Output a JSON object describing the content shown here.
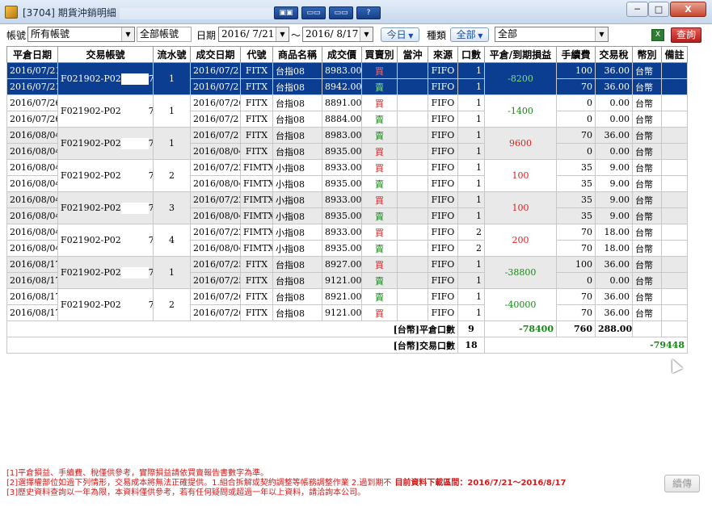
{
  "window": {
    "title": "[3704] 期貨沖銷明細",
    "buttons": [
      "▣▣",
      "▭▭",
      "▭▭",
      "?"
    ],
    "min_glyph": "─",
    "max_glyph": "□",
    "close_glyph": "X"
  },
  "toolbar": {
    "account_label": "帳號",
    "account_value": "所有帳號",
    "account_name": "全部帳號",
    "date_label": "日期",
    "date_from": "2016/ 7/21",
    "date_sep": "〜",
    "date_to": "2016/ 8/17",
    "today_label": "今日",
    "kind_label": "種類",
    "kind_value": "全部",
    "filter_value": "全部",
    "excel_icon": "X",
    "query_label": "查詢"
  },
  "columns": [
    "平倉日期",
    "交易帳號",
    "流水號",
    "成交日期",
    "代號",
    "商品名稱",
    "成交價",
    "買賣別",
    "當沖",
    "來源",
    "口數",
    "平倉/到期損益",
    "手續費",
    "交易稅",
    "幣別",
    "備註"
  ],
  "groups": [
    {
      "close_date": [
        "2016/07/21",
        "2016/07/21"
      ],
      "account": "F021902-P02",
      "acct_tail": "7",
      "serial": "1",
      "pnl": "-8200",
      "pnl_sign": "neg",
      "selected": true,
      "rows": [
        {
          "trade_date": "2016/07/21",
          "code": "FITX",
          "name": "台指08",
          "price": "8983.00",
          "side": "買",
          "side_cls": "buy",
          "daytrade": "",
          "source": "FIFO",
          "qty": "1",
          "fee": "100",
          "tax": "36.00",
          "currency": "台幣",
          "note": ""
        },
        {
          "trade_date": "2016/07/21",
          "code": "FITX",
          "name": "台指08",
          "price": "8942.00",
          "side": "賣",
          "side_cls": "sell",
          "daytrade": "",
          "source": "FIFO",
          "qty": "1",
          "fee": "70",
          "tax": "36.00",
          "currency": "台幣",
          "note": ""
        }
      ]
    },
    {
      "close_date": [
        "2016/07/26",
        "2016/07/26"
      ],
      "account": "F021902-P02",
      "acct_tail": "7",
      "serial": "1",
      "pnl": "-1400",
      "pnl_sign": "neg",
      "selected": false,
      "rows": [
        {
          "trade_date": "2016/07/26",
          "code": "FITX",
          "name": "台指08",
          "price": "8891.00",
          "side": "買",
          "side_cls": "buy",
          "daytrade": "",
          "source": "FIFO",
          "qty": "1",
          "fee": "0",
          "tax": "0.00",
          "currency": "台幣",
          "note": ""
        },
        {
          "trade_date": "2016/07/21",
          "code": "FITX",
          "name": "台指08",
          "price": "8884.00",
          "side": "賣",
          "side_cls": "sell",
          "daytrade": "",
          "source": "FIFO",
          "qty": "1",
          "fee": "0",
          "tax": "0.00",
          "currency": "台幣",
          "note": ""
        }
      ]
    },
    {
      "close_date": [
        "2016/08/04",
        "2016/08/04"
      ],
      "account": "F021902-P02",
      "acct_tail": "7",
      "serial": "1",
      "pnl": "9600",
      "pnl_sign": "pos",
      "selected": false,
      "rows": [
        {
          "trade_date": "2016/07/21",
          "code": "FITX",
          "name": "台指08",
          "price": "8983.00",
          "side": "賣",
          "side_cls": "sell",
          "daytrade": "",
          "source": "FIFO",
          "qty": "1",
          "fee": "70",
          "tax": "36.00",
          "currency": "台幣",
          "note": ""
        },
        {
          "trade_date": "2016/08/04",
          "code": "FITX",
          "name": "台指08",
          "price": "8935.00",
          "side": "買",
          "side_cls": "buy",
          "daytrade": "",
          "source": "FIFO",
          "qty": "1",
          "fee": "0",
          "tax": "0.00",
          "currency": "台幣",
          "note": ""
        }
      ]
    },
    {
      "close_date": [
        "2016/08/04",
        "2016/08/04"
      ],
      "account": "F021902-P02",
      "acct_tail": "7",
      "serial": "2",
      "pnl": "100",
      "pnl_sign": "pos",
      "selected": false,
      "rows": [
        {
          "trade_date": "2016/07/22",
          "code": "FIMTX",
          "name": "小指08",
          "price": "8933.00",
          "side": "買",
          "side_cls": "buy",
          "daytrade": "",
          "source": "FIFO",
          "qty": "1",
          "fee": "35",
          "tax": "9.00",
          "currency": "台幣",
          "note": ""
        },
        {
          "trade_date": "2016/08/04",
          "code": "FIMTX",
          "name": "小指08",
          "price": "8935.00",
          "side": "賣",
          "side_cls": "sell",
          "daytrade": "",
          "source": "FIFO",
          "qty": "1",
          "fee": "35",
          "tax": "9.00",
          "currency": "台幣",
          "note": ""
        }
      ]
    },
    {
      "close_date": [
        "2016/08/04",
        "2016/08/04"
      ],
      "account": "F021902-P02",
      "acct_tail": "7",
      "serial": "3",
      "pnl": "100",
      "pnl_sign": "pos",
      "selected": false,
      "rows": [
        {
          "trade_date": "2016/07/22",
          "code": "FIMTX",
          "name": "小指08",
          "price": "8933.00",
          "side": "買",
          "side_cls": "buy",
          "daytrade": "",
          "source": "FIFO",
          "qty": "1",
          "fee": "35",
          "tax": "9.00",
          "currency": "台幣",
          "note": ""
        },
        {
          "trade_date": "2016/08/04",
          "code": "FIMTX",
          "name": "小指08",
          "price": "8935.00",
          "side": "賣",
          "side_cls": "sell",
          "daytrade": "",
          "source": "FIFO",
          "qty": "1",
          "fee": "35",
          "tax": "9.00",
          "currency": "台幣",
          "note": ""
        }
      ]
    },
    {
      "close_date": [
        "2016/08/04",
        "2016/08/04"
      ],
      "account": "F021902-P02",
      "acct_tail": "7",
      "serial": "4",
      "pnl": "200",
      "pnl_sign": "pos",
      "selected": false,
      "rows": [
        {
          "trade_date": "2016/07/22",
          "code": "FIMTX",
          "name": "小指08",
          "price": "8933.00",
          "side": "買",
          "side_cls": "buy",
          "daytrade": "",
          "source": "FIFO",
          "qty": "2",
          "fee": "70",
          "tax": "18.00",
          "currency": "台幣",
          "note": ""
        },
        {
          "trade_date": "2016/08/04",
          "code": "FIMTX",
          "name": "小指08",
          "price": "8935.00",
          "side": "賣",
          "side_cls": "sell",
          "daytrade": "",
          "source": "FIFO",
          "qty": "2",
          "fee": "70",
          "tax": "18.00",
          "currency": "台幣",
          "note": ""
        }
      ]
    },
    {
      "close_date": [
        "2016/08/17",
        "2016/08/17"
      ],
      "account": "F021902-P02",
      "acct_tail": "7",
      "serial": "1",
      "pnl": "-38800",
      "pnl_sign": "neg",
      "selected": false,
      "rows": [
        {
          "trade_date": "2016/07/25",
          "code": "FITX",
          "name": "台指08",
          "price": "8927.00",
          "side": "買",
          "side_cls": "buy",
          "daytrade": "",
          "source": "FIFO",
          "qty": "1",
          "fee": "100",
          "tax": "36.00",
          "currency": "台幣",
          "note": ""
        },
        {
          "trade_date": "2016/07/25",
          "code": "FITX",
          "name": "台指08",
          "price": "9121.00",
          "side": "賣",
          "side_cls": "sell",
          "daytrade": "",
          "source": "FIFO",
          "qty": "1",
          "fee": "0",
          "tax": "0.00",
          "currency": "台幣",
          "note": ""
        }
      ]
    },
    {
      "close_date": [
        "2016/08/17",
        "2016/08/17"
      ],
      "account": "F021902-P02",
      "acct_tail": "7",
      "serial": "2",
      "pnl": "-40000",
      "pnl_sign": "neg",
      "selected": false,
      "rows": [
        {
          "trade_date": "2016/07/26",
          "code": "FITX",
          "name": "台指08",
          "price": "8921.00",
          "side": "賣",
          "side_cls": "sell",
          "daytrade": "",
          "source": "FIFO",
          "qty": "1",
          "fee": "70",
          "tax": "36.00",
          "currency": "台幣",
          "note": ""
        },
        {
          "trade_date": "2016/07/26",
          "code": "FITX",
          "name": "台指08",
          "price": "9121.00",
          "side": "買",
          "side_cls": "buy",
          "daytrade": "",
          "source": "FIFO",
          "qty": "1",
          "fee": "70",
          "tax": "36.00",
          "currency": "台幣",
          "note": ""
        }
      ]
    }
  ],
  "summary": {
    "close_label": "[台幣]平倉口數",
    "close_qty": "9",
    "close_pnl": "-78400",
    "close_fee": "760",
    "close_tax": "288.00",
    "trade_label": "[台幣]交易口數",
    "trade_qty": "18",
    "trade_net": "-79448"
  },
  "footer": {
    "note1": "[1]平倉損益、手續費、稅僅供參考，實際損益請依買賣報告書數字為準。",
    "note2": "[2]選擇權部位如過下列情形，交易成本將無法正確提供。1.組合拆解或契約調整等帳務調整作業 2.過到期不",
    "range": "目前資料下載區間：2016/7/21〜2016/8/17",
    "note3": "[3]歷史資料查詢以一年為限，本資料僅供參考，若有任何疑問或超過一年以上資料，請洽詢本公司。",
    "reset_label": "續傳"
  }
}
